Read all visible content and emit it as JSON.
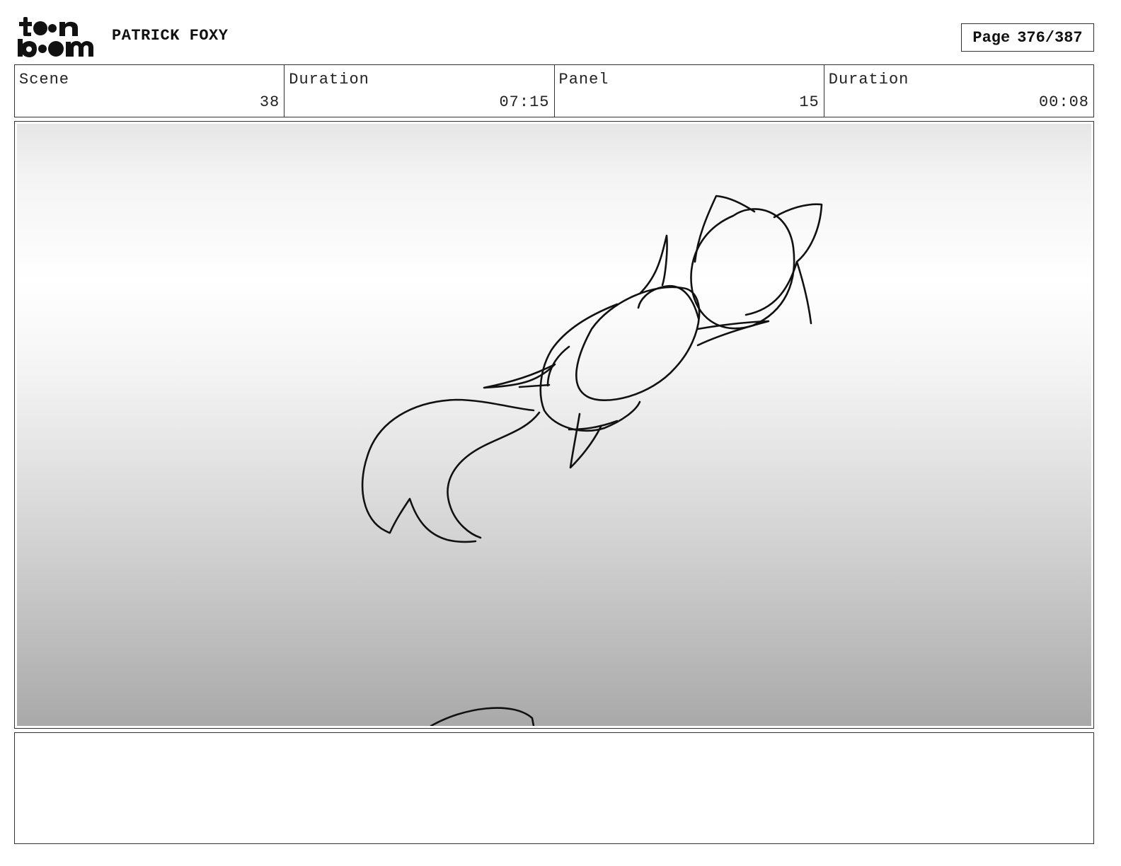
{
  "header": {
    "logo_text": "toon boom",
    "project_title": "PATRICK FOXY",
    "page_label": "Page",
    "page_number": "376/387"
  },
  "info": {
    "scene_label": "Scene",
    "scene_value": "38",
    "scene_duration_label": "Duration",
    "scene_duration_value": "07:15",
    "panel_label": "Panel",
    "panel_value": "15",
    "panel_duration_label": "Duration",
    "panel_duration_value": "00:08"
  },
  "panel": {
    "content": "fox-sketch"
  },
  "notes": {
    "text": ""
  }
}
